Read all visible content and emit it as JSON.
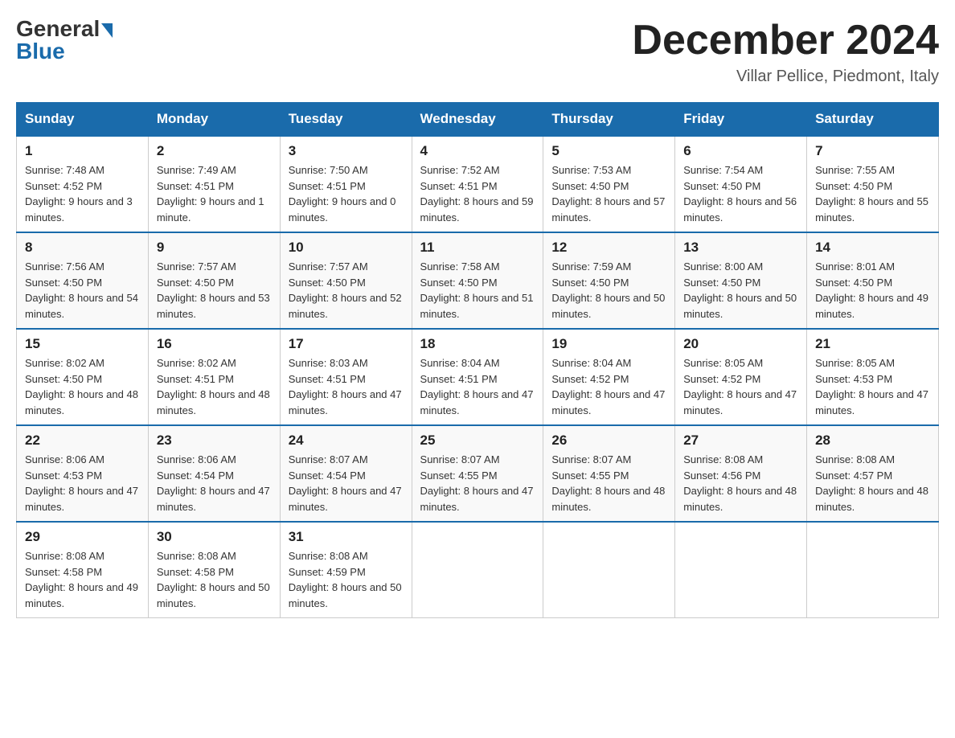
{
  "logo": {
    "general": "General",
    "blue": "Blue"
  },
  "title": "December 2024",
  "subtitle": "Villar Pellice, Piedmont, Italy",
  "weekdays": [
    "Sunday",
    "Monday",
    "Tuesday",
    "Wednesday",
    "Thursday",
    "Friday",
    "Saturday"
  ],
  "weeks": [
    [
      {
        "day": "1",
        "sunrise": "7:48 AM",
        "sunset": "4:52 PM",
        "daylight": "9 hours and 3 minutes."
      },
      {
        "day": "2",
        "sunrise": "7:49 AM",
        "sunset": "4:51 PM",
        "daylight": "9 hours and 1 minute."
      },
      {
        "day": "3",
        "sunrise": "7:50 AM",
        "sunset": "4:51 PM",
        "daylight": "9 hours and 0 minutes."
      },
      {
        "day": "4",
        "sunrise": "7:52 AM",
        "sunset": "4:51 PM",
        "daylight": "8 hours and 59 minutes."
      },
      {
        "day": "5",
        "sunrise": "7:53 AM",
        "sunset": "4:50 PM",
        "daylight": "8 hours and 57 minutes."
      },
      {
        "day": "6",
        "sunrise": "7:54 AM",
        "sunset": "4:50 PM",
        "daylight": "8 hours and 56 minutes."
      },
      {
        "day": "7",
        "sunrise": "7:55 AM",
        "sunset": "4:50 PM",
        "daylight": "8 hours and 55 minutes."
      }
    ],
    [
      {
        "day": "8",
        "sunrise": "7:56 AM",
        "sunset": "4:50 PM",
        "daylight": "8 hours and 54 minutes."
      },
      {
        "day": "9",
        "sunrise": "7:57 AM",
        "sunset": "4:50 PM",
        "daylight": "8 hours and 53 minutes."
      },
      {
        "day": "10",
        "sunrise": "7:57 AM",
        "sunset": "4:50 PM",
        "daylight": "8 hours and 52 minutes."
      },
      {
        "day": "11",
        "sunrise": "7:58 AM",
        "sunset": "4:50 PM",
        "daylight": "8 hours and 51 minutes."
      },
      {
        "day": "12",
        "sunrise": "7:59 AM",
        "sunset": "4:50 PM",
        "daylight": "8 hours and 50 minutes."
      },
      {
        "day": "13",
        "sunrise": "8:00 AM",
        "sunset": "4:50 PM",
        "daylight": "8 hours and 50 minutes."
      },
      {
        "day": "14",
        "sunrise": "8:01 AM",
        "sunset": "4:50 PM",
        "daylight": "8 hours and 49 minutes."
      }
    ],
    [
      {
        "day": "15",
        "sunrise": "8:02 AM",
        "sunset": "4:50 PM",
        "daylight": "8 hours and 48 minutes."
      },
      {
        "day": "16",
        "sunrise": "8:02 AM",
        "sunset": "4:51 PM",
        "daylight": "8 hours and 48 minutes."
      },
      {
        "day": "17",
        "sunrise": "8:03 AM",
        "sunset": "4:51 PM",
        "daylight": "8 hours and 47 minutes."
      },
      {
        "day": "18",
        "sunrise": "8:04 AM",
        "sunset": "4:51 PM",
        "daylight": "8 hours and 47 minutes."
      },
      {
        "day": "19",
        "sunrise": "8:04 AM",
        "sunset": "4:52 PM",
        "daylight": "8 hours and 47 minutes."
      },
      {
        "day": "20",
        "sunrise": "8:05 AM",
        "sunset": "4:52 PM",
        "daylight": "8 hours and 47 minutes."
      },
      {
        "day": "21",
        "sunrise": "8:05 AM",
        "sunset": "4:53 PM",
        "daylight": "8 hours and 47 minutes."
      }
    ],
    [
      {
        "day": "22",
        "sunrise": "8:06 AM",
        "sunset": "4:53 PM",
        "daylight": "8 hours and 47 minutes."
      },
      {
        "day": "23",
        "sunrise": "8:06 AM",
        "sunset": "4:54 PM",
        "daylight": "8 hours and 47 minutes."
      },
      {
        "day": "24",
        "sunrise": "8:07 AM",
        "sunset": "4:54 PM",
        "daylight": "8 hours and 47 minutes."
      },
      {
        "day": "25",
        "sunrise": "8:07 AM",
        "sunset": "4:55 PM",
        "daylight": "8 hours and 47 minutes."
      },
      {
        "day": "26",
        "sunrise": "8:07 AM",
        "sunset": "4:55 PM",
        "daylight": "8 hours and 48 minutes."
      },
      {
        "day": "27",
        "sunrise": "8:08 AM",
        "sunset": "4:56 PM",
        "daylight": "8 hours and 48 minutes."
      },
      {
        "day": "28",
        "sunrise": "8:08 AM",
        "sunset": "4:57 PM",
        "daylight": "8 hours and 48 minutes."
      }
    ],
    [
      {
        "day": "29",
        "sunrise": "8:08 AM",
        "sunset": "4:58 PM",
        "daylight": "8 hours and 49 minutes."
      },
      {
        "day": "30",
        "sunrise": "8:08 AM",
        "sunset": "4:58 PM",
        "daylight": "8 hours and 50 minutes."
      },
      {
        "day": "31",
        "sunrise": "8:08 AM",
        "sunset": "4:59 PM",
        "daylight": "8 hours and 50 minutes."
      },
      null,
      null,
      null,
      null
    ]
  ]
}
